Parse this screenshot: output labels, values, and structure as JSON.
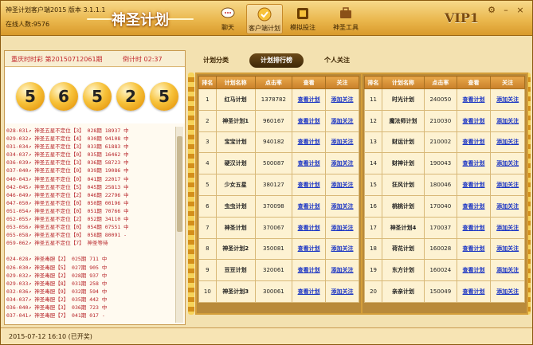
{
  "titlebar": {
    "title": "神圣计划客户端2015 版本 3.1.1.1",
    "online": "在线人数:9576",
    "logo": "神圣计划",
    "vip": "VIP1"
  },
  "nav": [
    {
      "label": "聊天",
      "icon": "chat-icon"
    },
    {
      "label": "客户端计划",
      "icon": "plan-icon"
    },
    {
      "label": "模拟投注",
      "icon": "bet-icon"
    },
    {
      "label": "神圣工具",
      "icon": "tools-icon"
    }
  ],
  "left": {
    "draw_info": "重庆时时彩 第20150712061期",
    "countdown": "倒计时 02:37",
    "balls": [
      "5",
      "6",
      "5",
      "2",
      "5"
    ],
    "records_a": [
      "028-031↗ 神圣五星不定位【3】 028期 18937 中",
      "029-032↗ 神圣五星不定位【4】 030期 94108 中",
      "031-034↗ 神圣五星不定位【3】 033期 61883 中",
      "034-037↗ 神圣五星不定位【0】 035期 16462 中",
      "036-039↗ 神圣五星不定位【3】 036期 58723 中",
      "037-040↗ 神圣五星不定位【0】 039期 19086 中",
      "040-043↗ 神圣五星不定位【0】 041期 22017 中",
      "042-045↗ 神圣五星不定位【5】 045期 25813 中",
      "046-049↗ 神圣五星不定位【2】 046期 22796 中",
      "047-050↗ 神圣五星不定位【0】 050期 00196 中",
      "051-054↗ 神圣五星不定位【0】 051期 70766 中",
      "052-055↗ 神圣五星不定位【2】 052期 34110 中",
      "053-056↗ 神圣五星不定位【0】 054期 07551 中",
      "055-058↗ 神圣五星不定位【0】 058期 80091 -",
      "059-062↗ 神圣五星不定位【7】 神圣等待"
    ],
    "records_b": [
      "024-028↗ 神圣毒胆【2】 025期 711 中",
      "026-030↗ 神圣毒胆【5】 027期 905 中",
      "029-032↗ 神圣毒胆【2】 028期 937 中",
      "029-033↗ 神圣毒胆【8】 031期 258 中",
      "032-036↗ 神圣毒胆【9】 032期 594 中",
      "034-037↗ 神圣毒胆【2】 035期 442 中",
      "036-040↗ 神圣毒胆【3】 036期 723 中",
      "037-041↗ 神圣毒胆【7】 041期 017 -"
    ]
  },
  "tabs": [
    "计划分类",
    "计划排行榜",
    "个人关注"
  ],
  "table_headers": [
    "排名",
    "计划名称",
    "点击率",
    "查看",
    "关注"
  ],
  "view_label": "查看计划",
  "follow_label": "添加关注",
  "table_left": [
    {
      "rank": "1",
      "name": "红马计划",
      "clicks": "1378782"
    },
    {
      "rank": "2",
      "name": "神圣计划1",
      "clicks": "960167"
    },
    {
      "rank": "3",
      "name": "宝宝计划",
      "clicks": "940182"
    },
    {
      "rank": "4",
      "name": "硬汉计划",
      "clicks": "500087"
    },
    {
      "rank": "5",
      "name": "少女五星",
      "clicks": "380127"
    },
    {
      "rank": "6",
      "name": "虫虫计划",
      "clicks": "370098"
    },
    {
      "rank": "7",
      "name": "神圣计划",
      "clicks": "370067"
    },
    {
      "rank": "8",
      "name": "神圣计划2",
      "clicks": "350081"
    },
    {
      "rank": "9",
      "name": "豆豆计划",
      "clicks": "320061"
    },
    {
      "rank": "10",
      "name": "神圣计划3",
      "clicks": "300061"
    }
  ],
  "table_right": [
    {
      "rank": "11",
      "name": "时光计划",
      "clicks": "240050"
    },
    {
      "rank": "12",
      "name": "魔法师计划",
      "clicks": "210030"
    },
    {
      "rank": "13",
      "name": "财运计划",
      "clicks": "210002"
    },
    {
      "rank": "14",
      "name": "财神计划",
      "clicks": "190043"
    },
    {
      "rank": "15",
      "name": "狂风计划",
      "clicks": "180046"
    },
    {
      "rank": "16",
      "name": "桃桃计划",
      "clicks": "170040"
    },
    {
      "rank": "17",
      "name": "神圣计划4",
      "clicks": "170037"
    },
    {
      "rank": "18",
      "name": "荷花计划",
      "clicks": "160028"
    },
    {
      "rank": "19",
      "name": "东方计划",
      "clicks": "160024"
    },
    {
      "rank": "20",
      "name": "亲亲计划",
      "clicks": "150049"
    }
  ],
  "status": "2015-07-12 16:10 (已开奖)",
  "colors": {
    "accent": "#c1272d",
    "link": "#1a34c4",
    "header": "#c9802a"
  }
}
